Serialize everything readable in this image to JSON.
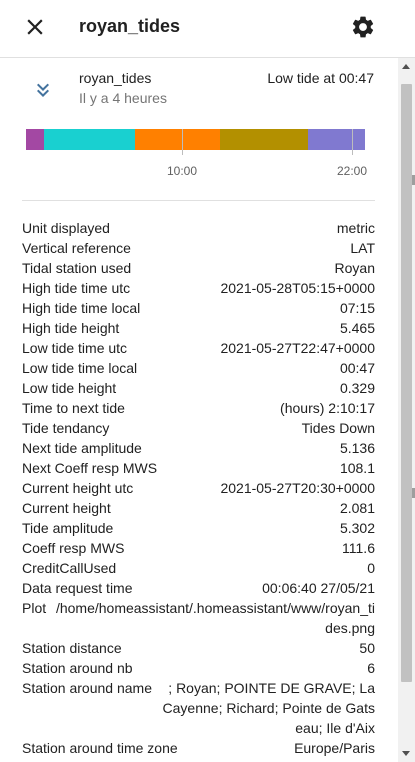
{
  "header": {
    "title": "royan_tides",
    "close_icon": "close-icon",
    "settings_icon": "gear-icon"
  },
  "entity": {
    "icon": "chevron-double-down-icon",
    "name": "royan_tides",
    "last_changed": "Il y a 4 heures",
    "state": "Low tide at 00:47"
  },
  "timeline": {
    "segments": [
      {
        "color": "#a348a3",
        "fraction": 0.053
      },
      {
        "color": "#19d0d0",
        "fraction": 0.27
      },
      {
        "color": "#ff8000",
        "fraction": 0.25
      },
      {
        "color": "#b39000",
        "fraction": 0.26
      },
      {
        "color": "#8079d0",
        "fraction": 0.167
      }
    ],
    "ticks": [
      {
        "label": "10:00"
      },
      {
        "label": "22:00"
      }
    ]
  },
  "attributes": [
    {
      "key": "Unit displayed",
      "value": "metric"
    },
    {
      "key": "Vertical reference",
      "value": "LAT"
    },
    {
      "key": "Tidal station used",
      "value": "Royan"
    },
    {
      "key": "High tide time utc",
      "value": "2021-05-28T05:15+0000"
    },
    {
      "key": "High tide time local",
      "value": "07:15"
    },
    {
      "key": "High tide height",
      "value": "5.465"
    },
    {
      "key": "Low tide time utc",
      "value": "2021-05-27T22:47+0000"
    },
    {
      "key": "Low tide time local",
      "value": "00:47"
    },
    {
      "key": "Low tide height",
      "value": "0.329"
    },
    {
      "key": "Time to next tide",
      "value": "(hours) 2:10:17"
    },
    {
      "key": "Tide tendancy",
      "value": "Tides Down"
    },
    {
      "key": "Next tide amplitude",
      "value": "5.136"
    },
    {
      "key": "Next Coeff resp MWS",
      "value": "108.1"
    },
    {
      "key": "Current height utc",
      "value": "2021-05-27T20:30+0000"
    },
    {
      "key": "Current height",
      "value": "2.081"
    },
    {
      "key": "Tide amplitude",
      "value": "5.302"
    },
    {
      "key": "Coeff resp MWS",
      "value": "111.6"
    },
    {
      "key": "CreditCallUsed",
      "value": "0"
    },
    {
      "key": "Data request time",
      "value": "00:06:40 27/05/21"
    },
    {
      "key": "Plot",
      "value": "/home/homeassistant/.homeassistant/www/royan_tides.png"
    },
    {
      "key": "Station distance",
      "value": "50"
    },
    {
      "key": "Station around nb",
      "value": "6"
    },
    {
      "key": "Station around name",
      "value": "; Royan; POINTE DE GRAVE; La Cayenne; Richard; Pointe de Gatseau; Ile d'Aix"
    },
    {
      "key": "Station around time zone",
      "value": "Europe/Paris"
    }
  ]
}
